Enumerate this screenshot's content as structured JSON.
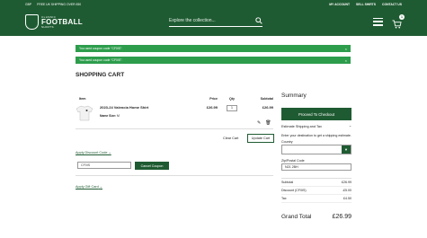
{
  "topbar": {
    "currency": "GBP",
    "shipping_banner": "FREE UK SHIPPING OVER £50",
    "links": [
      "MY ACCOUNT",
      "SELL SHIRTS",
      "CONTACT US"
    ]
  },
  "logo": {
    "line1": "CLASSIC",
    "line2": "FOOTBALL",
    "line3": "SHIRTS"
  },
  "search": {
    "placeholder": "Explore the collection..."
  },
  "cart": {
    "count": "1"
  },
  "messages": [
    "You used coupon code \"CF0IS\".",
    "You used coupon code \"CF0IS\"."
  ],
  "page_title": "SHOPPING CART",
  "table": {
    "headers": {
      "item": "Item",
      "price": "Price",
      "qty": "Qty",
      "subtotal": "Subtotal"
    },
    "items": [
      {
        "name": "2023-24 Valencia Home Shirt",
        "option_label": "Name Size:",
        "option_value": "M",
        "price": "£26.99",
        "qty": "1",
        "subtotal": "£26.99"
      }
    ]
  },
  "buttons": {
    "clear_cart": "Clear Cart",
    "update_cart": "Update Cart",
    "cancel_coupon": "Cancel Coupon",
    "checkout": "Proceed To Checkout"
  },
  "discount": {
    "toggle": "Apply Discount Code",
    "code": "CF0IS"
  },
  "gift_card": {
    "toggle": "Apply Gift Card"
  },
  "summary": {
    "title": "Summary",
    "shipping_head": "Estimate Shipping and Tax",
    "shipping_desc": "Enter your destination to get a shipping estimate.",
    "country_label": "Country",
    "country_value": "",
    "postcode_label": "Zip/Postal Code",
    "postcode_value": "N21 2BH",
    "rows": [
      {
        "label": "Subtotal",
        "value": "£26.99"
      },
      {
        "label": "Discount (CF0IS)",
        "value": "-£5.00"
      },
      {
        "label": "Tax",
        "value": "£4.50"
      }
    ],
    "grand_label": "Grand Total",
    "grand_value": "£26.99"
  },
  "colors": {
    "brand_green": "#1f5b32",
    "success_green": "#2d9d4c"
  }
}
